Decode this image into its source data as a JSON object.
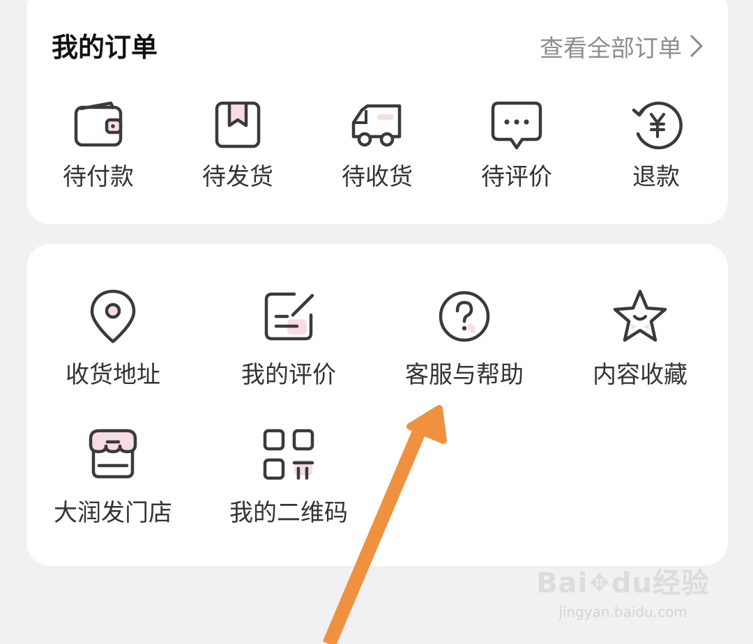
{
  "orders": {
    "title": "我的订单",
    "view_all": "查看全部订单",
    "items": [
      {
        "label": "待付款",
        "icon": "wallet-icon"
      },
      {
        "label": "待发货",
        "icon": "package-icon"
      },
      {
        "label": "待收货",
        "icon": "truck-icon"
      },
      {
        "label": "待评价",
        "icon": "comment-icon"
      },
      {
        "label": "退款",
        "icon": "refund-icon"
      }
    ]
  },
  "services": {
    "items": [
      {
        "label": "收货地址",
        "icon": "location-pin-icon"
      },
      {
        "label": "我的评价",
        "icon": "edit-note-icon"
      },
      {
        "label": "客服与帮助",
        "icon": "help-circle-icon"
      },
      {
        "label": "内容收藏",
        "icon": "star-icon"
      },
      {
        "label": "大润发门店",
        "icon": "store-icon"
      },
      {
        "label": "我的二维码",
        "icon": "qr-code-icon"
      }
    ]
  },
  "annotation": {
    "arrow_color": "#f0913f",
    "points_to": "客服与帮助"
  },
  "watermark": {
    "logo": "Bai du 经验",
    "logo_left": "Bai",
    "logo_right": "du",
    "logo_cn": "经验",
    "site": "jingyan.baidu.com"
  },
  "colors": {
    "background": "#f1f0f2",
    "card": "#ffffff",
    "icon_stroke": "#3a3a3a",
    "icon_accent": "#f7dde3",
    "muted_text": "#8d8d8d"
  }
}
